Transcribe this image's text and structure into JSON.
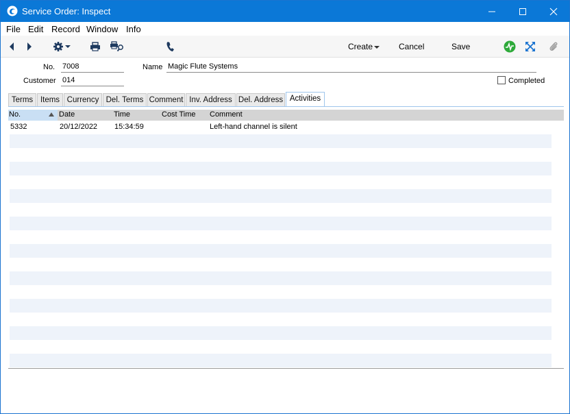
{
  "window": {
    "title": "Service Order: Inspect",
    "minimize_icon": "minimize-icon",
    "maximize_icon": "maximize-icon",
    "close_icon": "close-icon"
  },
  "menu": [
    "File",
    "Edit",
    "Record",
    "Window",
    "Info"
  ],
  "toolbar": {
    "create_label": "Create",
    "cancel_label": "Cancel",
    "save_label": "Save",
    "status_color": "#2eaa3a"
  },
  "header": {
    "no_label": "No.",
    "no_value": "7008",
    "name_label": "Name",
    "name_value": "Magic Flute Systems",
    "customer_label": "Customer",
    "customer_value": "014",
    "completed_label": "Completed",
    "completed_checked": false
  },
  "tabs": [
    "Terms",
    "Items",
    "Currency",
    "Del. Terms",
    "Comment",
    "Inv. Address",
    "Del. Address",
    "Activities"
  ],
  "active_tab": "Activities",
  "grid": {
    "columns": [
      "No.",
      "Date",
      "Time",
      "Cost Time",
      "Comment"
    ],
    "rows": [
      {
        "no": "5332",
        "date": "20/12/2022",
        "time": "15:34:59",
        "cost_time": "",
        "comment": "Left-hand channel is silent"
      }
    ]
  }
}
